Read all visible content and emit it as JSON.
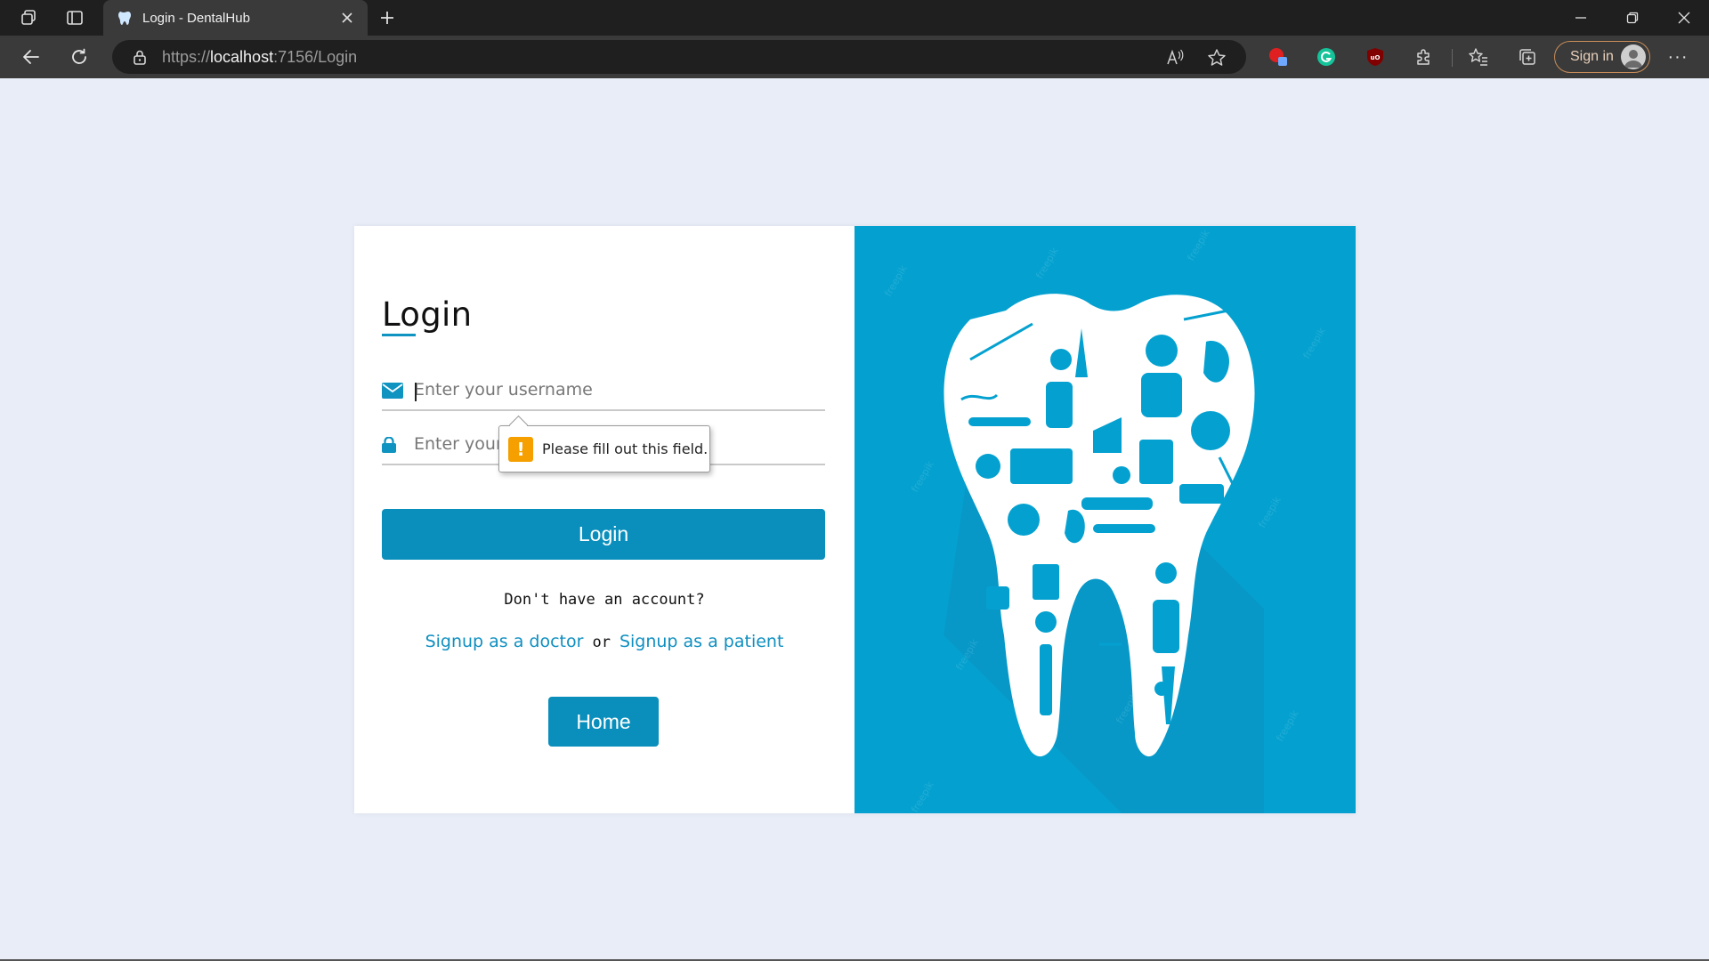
{
  "browser": {
    "tab_title": "Login - DentalHub",
    "url_protocol": "https://",
    "url_host": "localhost",
    "url_rest": ":7156/Login",
    "signin_label": "Sign in",
    "more_label": "···"
  },
  "login": {
    "title": "Login",
    "username_placeholder": "Enter your username",
    "password_placeholder": "Enter your password",
    "validation_message": "Please fill out this field.",
    "login_button": "Login",
    "no_account_text": "Don't have an account?",
    "signup_doctor": "Signup as a doctor",
    "or_text": "or",
    "signup_patient": "Signup as a patient",
    "home_button": "Home"
  },
  "colors": {
    "primary": "#0a8fbc",
    "image_panel": "#04a1d0",
    "page_background": "#e8edf7",
    "warning": "#f5a000"
  },
  "icons": {
    "username_field": "envelope-icon",
    "password_field": "lock-icon",
    "validation": "warning-icon",
    "illustration": "dental-tooth-collage"
  }
}
